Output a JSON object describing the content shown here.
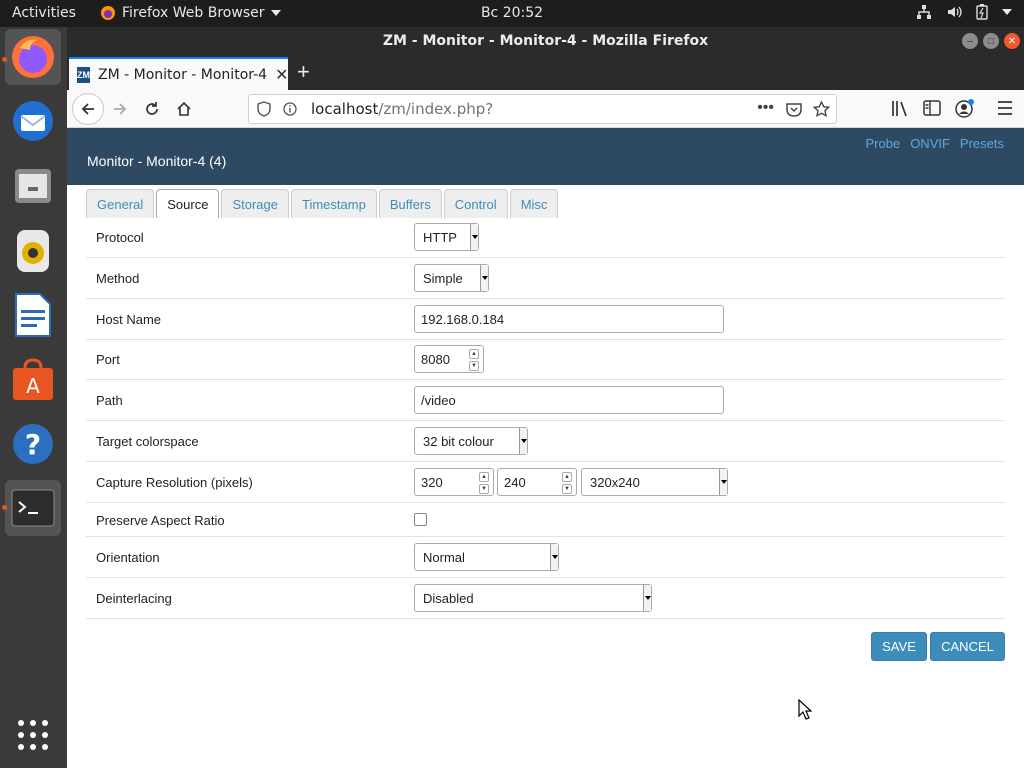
{
  "desktop": {
    "activities": "Activities",
    "app_menu": "Firefox Web Browser",
    "clock": "Вс 20:52"
  },
  "window": {
    "title": "ZM - Monitor - Monitor-4 - Mozilla Firefox"
  },
  "browser": {
    "tab_label": "ZM - Monitor - Monitor-4",
    "tab_favicon": "ZM",
    "url_host": "localhost",
    "url_path": "/zm/index.php?"
  },
  "zm": {
    "header_title": "Monitor - Monitor-4 (4)",
    "header_links": [
      "Probe",
      "ONVIF",
      "Presets"
    ],
    "tabs": [
      "General",
      "Source",
      "Storage",
      "Timestamp",
      "Buffers",
      "Control",
      "Misc"
    ],
    "active_tab": "Source",
    "fields": {
      "protocol": {
        "label": "Protocol",
        "value": "HTTP"
      },
      "method": {
        "label": "Method",
        "value": "Simple"
      },
      "host_name": {
        "label": "Host Name",
        "value": "192.168.0.184"
      },
      "port": {
        "label": "Port",
        "value": "8080"
      },
      "path": {
        "label": "Path",
        "value": "/video"
      },
      "target_colorspace": {
        "label": "Target colorspace",
        "value": "32 bit colour"
      },
      "capture_resolution": {
        "label": "Capture Resolution (pixels)",
        "width": "320",
        "height": "240",
        "preset": "320x240"
      },
      "preserve_aspect": {
        "label": "Preserve Aspect Ratio",
        "checked": false
      },
      "orientation": {
        "label": "Orientation",
        "value": "Normal"
      },
      "deinterlacing": {
        "label": "Deinterlacing",
        "value": "Disabled"
      }
    },
    "buttons": {
      "save": "SAVE",
      "cancel": "CANCEL"
    }
  },
  "colors": {
    "zm_header": "#2e4a62",
    "zm_link": "#5ea7e0",
    "button": "#3c8dbc",
    "ubuntu_orange": "#e95420"
  }
}
